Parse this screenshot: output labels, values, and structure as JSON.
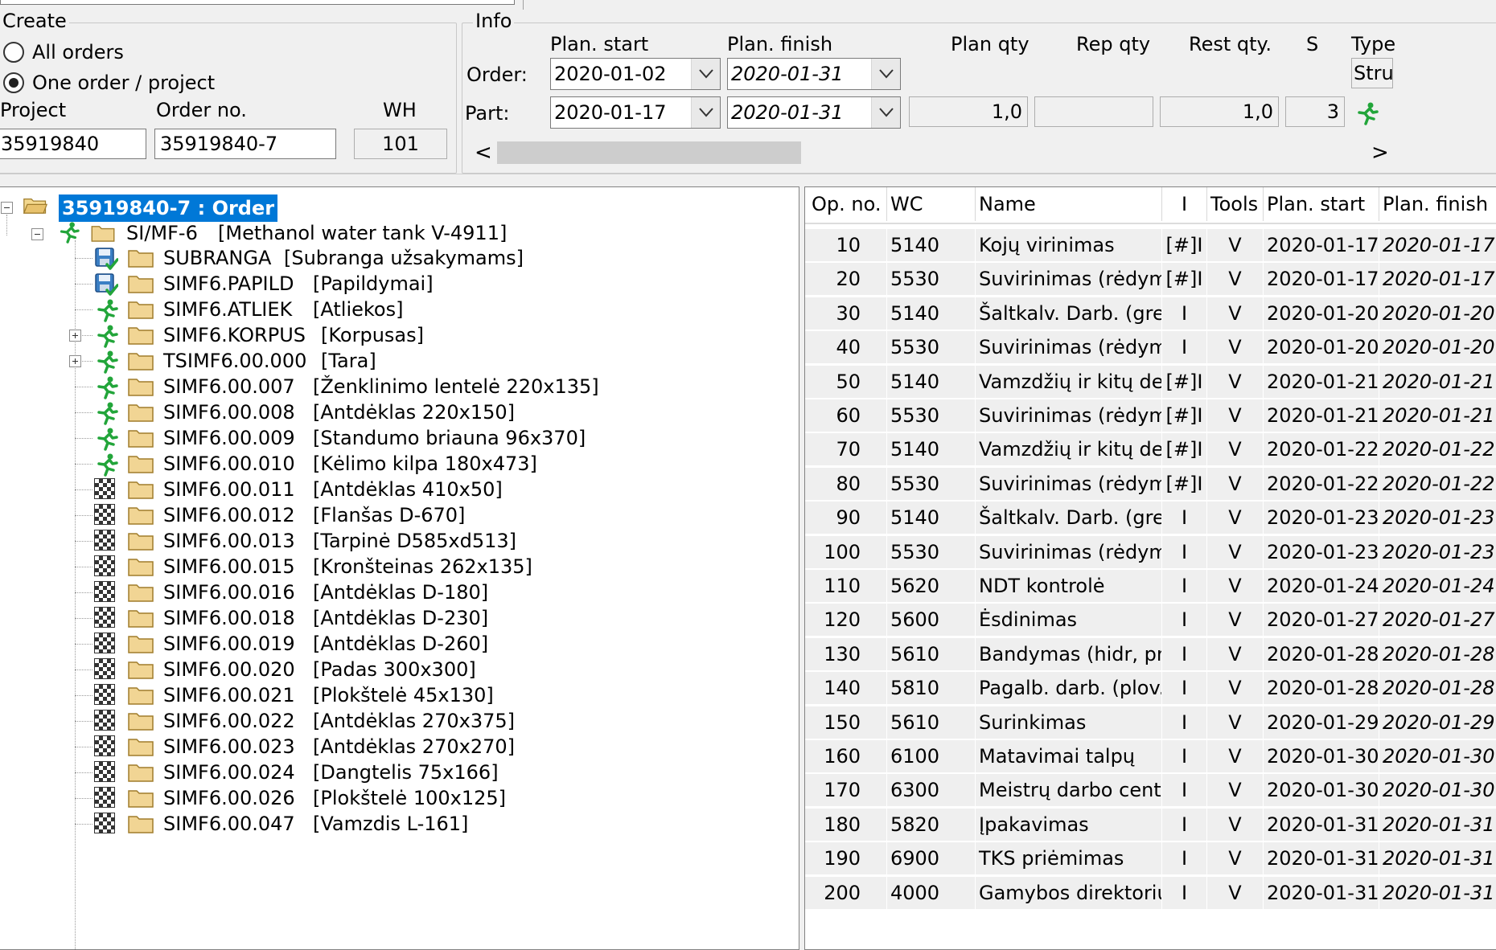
{
  "create": {
    "legend": "Create",
    "all_orders": "All orders",
    "one_order": "One order / project",
    "project_label": "Project",
    "order_no_label": "Order no.",
    "wh_label": "WH",
    "project_value": "35919840",
    "order_no_value": "35919840-7",
    "wh_value": "101"
  },
  "info": {
    "legend": "Info",
    "col_plan_start": "Plan. start",
    "col_plan_finish": "Plan. finish",
    "col_plan_qty": "Plan qty",
    "col_rep_qty": "Rep qty",
    "col_rest_qty": "Rest qty.",
    "col_s": "S",
    "col_type": "Type",
    "order_label": "Order:",
    "part_label": "Part:",
    "order_plan_start": "2020-01-02",
    "order_plan_finish": "2020-01-31",
    "order_type": "Stru",
    "part_plan_start": "2020-01-17",
    "part_plan_finish": "2020-01-31",
    "part_plan_qty": "1,0",
    "part_rep_qty": "",
    "part_rest_qty": "1,0",
    "part_s": "3",
    "scroll_left": "<",
    "scroll_right": ">"
  },
  "tree": {
    "root": "35919840-7 : Order",
    "level1": {
      "code": "SI/MF-6",
      "desc": "[Methanol water tank V-4911]"
    },
    "items": [
      {
        "code": "SUBRANGA",
        "desc": "[Subranga užsakymams]",
        "status": "saved",
        "expander": ""
      },
      {
        "code": "SIMF6.PAPILD",
        "desc": "[Papildymai]",
        "status": "saved",
        "expander": ""
      },
      {
        "code": "SIMF6.ATLIEK",
        "desc": "[Atliekos]",
        "status": "running",
        "expander": ""
      },
      {
        "code": "SIMF6.KORPUS",
        "desc": "[Korpusas]",
        "status": "running",
        "expander": "plus"
      },
      {
        "code": "TSIMF6.00.000",
        "desc": "[Tara]",
        "status": "running",
        "expander": "plus"
      },
      {
        "code": "SIMF6.00.007",
        "desc": "[Ženklinimo lentelė 220x135]",
        "status": "running",
        "expander": ""
      },
      {
        "code": "SIMF6.00.008",
        "desc": "[Antdėklas 220x150]",
        "status": "running",
        "expander": ""
      },
      {
        "code": "SIMF6.00.009",
        "desc": "[Standumo briauna 96x370]",
        "status": "running",
        "expander": ""
      },
      {
        "code": "SIMF6.00.010",
        "desc": "[Kėlimo kilpa 180x473]",
        "status": "running",
        "expander": ""
      },
      {
        "code": "SIMF6.00.011",
        "desc": "[Antdėklas 410x50]",
        "status": "finished",
        "expander": ""
      },
      {
        "code": "SIMF6.00.012",
        "desc": "[Flanšas D-670]",
        "status": "finished",
        "expander": ""
      },
      {
        "code": "SIMF6.00.013",
        "desc": "[Tarpinė D585xd513]",
        "status": "finished",
        "expander": ""
      },
      {
        "code": "SIMF6.00.015",
        "desc": "[Kronšteinas 262x135]",
        "status": "finished",
        "expander": ""
      },
      {
        "code": "SIMF6.00.016",
        "desc": "[Antdėklas D-180]",
        "status": "finished",
        "expander": ""
      },
      {
        "code": "SIMF6.00.018",
        "desc": "[Antdėklas D-230]",
        "status": "finished",
        "expander": ""
      },
      {
        "code": "SIMF6.00.019",
        "desc": "[Antdėklas D-260]",
        "status": "finished",
        "expander": ""
      },
      {
        "code": "SIMF6.00.020",
        "desc": "[Padas 300x300]",
        "status": "finished",
        "expander": ""
      },
      {
        "code": "SIMF6.00.021",
        "desc": "[Plokštelė 45x130]",
        "status": "finished",
        "expander": ""
      },
      {
        "code": "SIMF6.00.022",
        "desc": "[Antdėklas 270x375]",
        "status": "finished",
        "expander": ""
      },
      {
        "code": "SIMF6.00.023",
        "desc": "[Antdėklas 270x270]",
        "status": "finished",
        "expander": ""
      },
      {
        "code": "SIMF6.00.024",
        "desc": "[Dangtelis 75x166]",
        "status": "finished",
        "expander": ""
      },
      {
        "code": "SIMF6.00.026",
        "desc": "[Plokštelė 100x125]",
        "status": "finished",
        "expander": ""
      },
      {
        "code": "SIMF6.00.047",
        "desc": "[Vamzdis L-161]",
        "status": "finished",
        "expander": ""
      }
    ]
  },
  "ops": {
    "headers": {
      "op_no": "Op. no.",
      "wc": "WC",
      "name": "Name",
      "i": "I",
      "tools": "Tools",
      "plan_start": "Plan. start",
      "plan_finish": "Plan. finish"
    },
    "rows": [
      {
        "op": "10",
        "wc": "5140",
        "name": "Kojų virinimas",
        "i": "[#]I",
        "tools": "V",
        "start": "2020-01-17",
        "finish": "2020-01-17"
      },
      {
        "op": "20",
        "wc": "5530",
        "name": "Suvirinimas (rėdyma",
        "i": "[#]I",
        "tools": "V",
        "start": "2020-01-17",
        "finish": "2020-01-17"
      },
      {
        "op": "30",
        "wc": "5140",
        "name": "Šaltkalv. Darb. (gre:",
        "i": "I",
        "tools": "V",
        "start": "2020-01-20",
        "finish": "2020-01-20"
      },
      {
        "op": "40",
        "wc": "5530",
        "name": "Suvirinimas (rėdyma",
        "i": "I",
        "tools": "V",
        "start": "2020-01-20",
        "finish": "2020-01-20"
      },
      {
        "op": "50",
        "wc": "5140",
        "name": "Vamzdžių ir kitų deta",
        "i": "[#]I",
        "tools": "V",
        "start": "2020-01-21",
        "finish": "2020-01-21"
      },
      {
        "op": "60",
        "wc": "5530",
        "name": "Suvirinimas (rėdyma",
        "i": "[#]I",
        "tools": "V",
        "start": "2020-01-21",
        "finish": "2020-01-21"
      },
      {
        "op": "70",
        "wc": "5140",
        "name": "Vamzdžių ir kitų deta",
        "i": "[#]I",
        "tools": "V",
        "start": "2020-01-22",
        "finish": "2020-01-22"
      },
      {
        "op": "80",
        "wc": "5530",
        "name": "Suvirinimas (rėdyma",
        "i": "[#]I",
        "tools": "V",
        "start": "2020-01-22",
        "finish": "2020-01-22"
      },
      {
        "op": "90",
        "wc": "5140",
        "name": "Šaltkalv. Darb. (gre:",
        "i": "I",
        "tools": "V",
        "start": "2020-01-23",
        "finish": "2020-01-23"
      },
      {
        "op": "100",
        "wc": "5530",
        "name": "Suvirinimas (rėdyma",
        "i": "I",
        "tools": "V",
        "start": "2020-01-23",
        "finish": "2020-01-23"
      },
      {
        "op": "110",
        "wc": "5620",
        "name": "NDT kontrolė",
        "i": "I",
        "tools": "V",
        "start": "2020-01-24",
        "finish": "2020-01-24"
      },
      {
        "op": "120",
        "wc": "5600",
        "name": "Ėsdinimas",
        "i": "I",
        "tools": "V",
        "start": "2020-01-27",
        "finish": "2020-01-27"
      },
      {
        "op": "130",
        "wc": "5610",
        "name": "Bandymas (hidr, pne",
        "i": "I",
        "tools": "V",
        "start": "2020-01-28",
        "finish": "2020-01-28"
      },
      {
        "op": "140",
        "wc": "5810",
        "name": "Pagalb. darb. (plov.",
        "i": "I",
        "tools": "V",
        "start": "2020-01-28",
        "finish": "2020-01-28"
      },
      {
        "op": "150",
        "wc": "5610",
        "name": "Surinkimas",
        "i": "I",
        "tools": "V",
        "start": "2020-01-29",
        "finish": "2020-01-29"
      },
      {
        "op": "160",
        "wc": "6100",
        "name": "Matavimai talpų",
        "i": "I",
        "tools": "V",
        "start": "2020-01-30",
        "finish": "2020-01-30"
      },
      {
        "op": "170",
        "wc": "6300",
        "name": "Meistrų darbo centra",
        "i": "I",
        "tools": "V",
        "start": "2020-01-30",
        "finish": "2020-01-30"
      },
      {
        "op": "180",
        "wc": "5820",
        "name": "Įpakavimas",
        "i": "I",
        "tools": "V",
        "start": "2020-01-31",
        "finish": "2020-01-31"
      },
      {
        "op": "190",
        "wc": "6900",
        "name": "TKS priėmimas",
        "i": "I",
        "tools": "V",
        "start": "2020-01-31",
        "finish": "2020-01-31"
      },
      {
        "op": "200",
        "wc": "4000",
        "name": "Gamybos direktorius",
        "i": "I",
        "tools": "V",
        "start": "2020-01-31",
        "finish": "2020-01-31"
      }
    ]
  },
  "colors": {
    "selection": "#0078d7",
    "accent_green": "#22a53a",
    "folder": "#e8c26d"
  }
}
